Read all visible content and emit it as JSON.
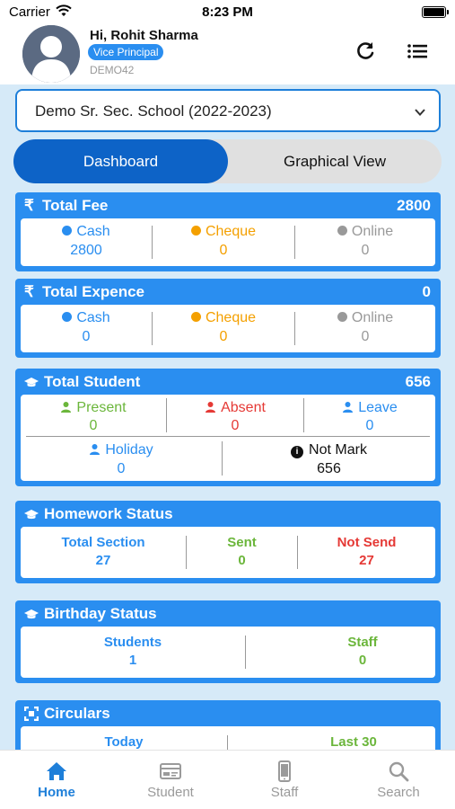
{
  "status_bar": {
    "carrier": "Carrier",
    "time": "8:23 PM"
  },
  "header": {
    "greeting": "Hi, Rohit Sharma",
    "role": "Vice Principal",
    "code": "DEMO42"
  },
  "school_select": {
    "value": "Demo Sr. Sec. School (2022-2023)"
  },
  "tabs": [
    {
      "label": "Dashboard",
      "active": true
    },
    {
      "label": "Graphical View",
      "active": false
    }
  ],
  "total_fee": {
    "title": "Total Fee",
    "value": "2800",
    "items": [
      {
        "label": "Cash",
        "value": "2800",
        "color": "#2a8ef0"
      },
      {
        "label": "Cheque",
        "value": "0",
        "color": "#f4a000"
      },
      {
        "label": "Online",
        "value": "0",
        "color": "#999999"
      }
    ]
  },
  "total_expence": {
    "title": "Total Expence",
    "value": "0",
    "items": [
      {
        "label": "Cash",
        "value": "0",
        "color": "#2a8ef0"
      },
      {
        "label": "Cheque",
        "value": "0",
        "color": "#f4a000"
      },
      {
        "label": "Online",
        "value": "0",
        "color": "#999999"
      }
    ]
  },
  "total_student": {
    "title": "Total Student",
    "value": "656",
    "present": {
      "label": "Present",
      "value": "0"
    },
    "absent": {
      "label": "Absent",
      "value": "0"
    },
    "leave": {
      "label": "Leave",
      "value": "0"
    },
    "holiday": {
      "label": "Holiday",
      "value": "0"
    },
    "not_mark": {
      "label": "Not Mark",
      "value": "656"
    }
  },
  "homework_status": {
    "title": "Homework Status",
    "total_section": {
      "label": "Total Section",
      "value": "27"
    },
    "sent": {
      "label": "Sent",
      "value": "0"
    },
    "not_send": {
      "label": "Not Send",
      "value": "27"
    }
  },
  "birthday_status": {
    "title": "Birthday Status",
    "students": {
      "label": "Students",
      "value": "1"
    },
    "staff": {
      "label": "Staff",
      "value": "0"
    }
  },
  "circulars": {
    "title": "Circulars",
    "left_label": "Today",
    "right_label": "Last 30"
  },
  "tab_bar": [
    {
      "label": "Home",
      "icon": "home-icon",
      "active": true
    },
    {
      "label": "Student",
      "icon": "id-card-icon",
      "active": false
    },
    {
      "label": "Staff",
      "icon": "phone-icon",
      "active": false
    },
    {
      "label": "Search",
      "icon": "search-icon",
      "active": false
    }
  ],
  "colors": {
    "primary": "#2a8ef0",
    "dark_primary": "#0d63c7",
    "background": "#d6eaf8",
    "cheque": "#f4a000",
    "sent": "#6bb63b",
    "not_send": "#e53935"
  }
}
